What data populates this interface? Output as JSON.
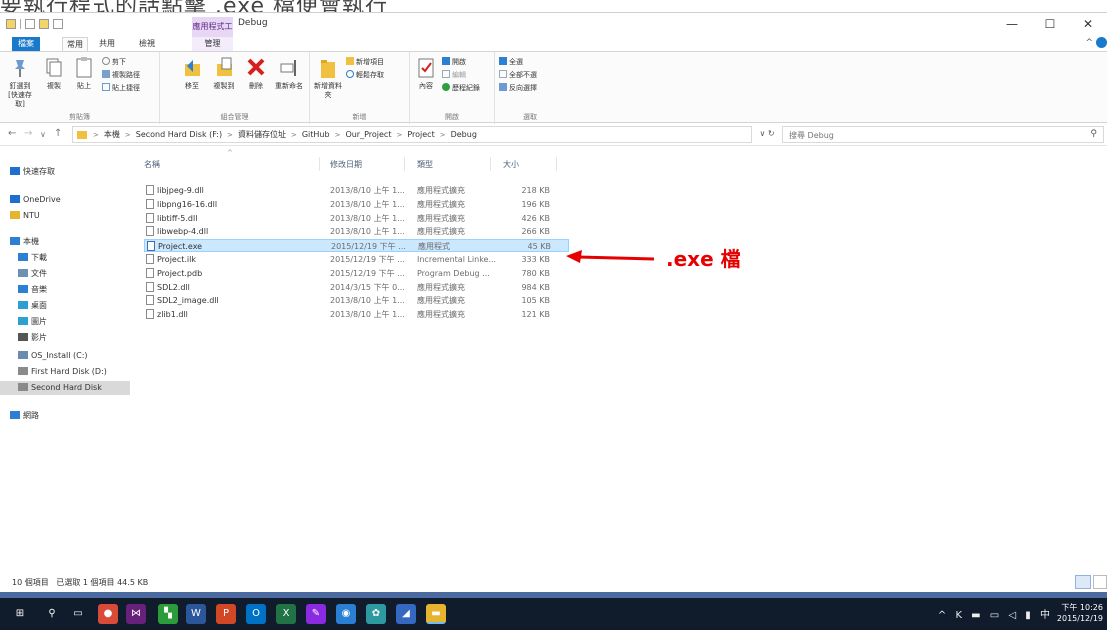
{
  "caption": {
    "partial_text": "要執行程式的話點擊 .exe 檔便會執行"
  },
  "window": {
    "title": "Debug",
    "context_tab_label": "應用程式工具",
    "controls": {
      "minimize": "—",
      "maximize": "☐",
      "close": "✕"
    }
  },
  "ribbon_tabs": {
    "file": "檔案",
    "home": "常用",
    "share": "共用",
    "view": "檢視",
    "manage": "管理",
    "collapse": "^"
  },
  "ribbon": {
    "clipboard": {
      "label": "剪貼簿",
      "pin": "釘選到 [快速存取]",
      "copy": "複製",
      "paste": "貼上",
      "cut": "剪下",
      "copy_path": "複製路徑",
      "paste_shortcut": "貼上捷徑"
    },
    "organize": {
      "label": "組合管理",
      "move_to": "移至",
      "copy_to": "複製到",
      "delete": "刪除",
      "rename": "重新命名"
    },
    "new": {
      "label": "新增",
      "new_folder": "新增資料夾",
      "new_item": "新增項目",
      "easy_access": "輕鬆存取"
    },
    "open": {
      "label": "開啟",
      "properties": "內容",
      "open": "開啟",
      "edit": "編輯",
      "history": "歷程紀錄"
    },
    "select": {
      "label": "選取",
      "select_all": "全選",
      "select_none": "全部不選",
      "invert": "反向選擇"
    }
  },
  "address": {
    "back": "←",
    "forward": "→",
    "recent": "∨",
    "up": "↑",
    "crumbs": [
      "本機",
      "Second Hard Disk (F:)",
      "資料儲存位址",
      "GitHub",
      "Our_Project",
      "Project",
      "Debug"
    ],
    "dropdown": "∨",
    "refresh": "↻",
    "search_placeholder": "搜尋 Debug"
  },
  "nav": {
    "items": [
      {
        "label": "快速存取",
        "icon": "star-icon",
        "color": "#1e6fd0"
      },
      {
        "label": "OneDrive",
        "icon": "cloud-icon",
        "color": "#1e6fd0"
      },
      {
        "label": "NTU",
        "icon": "folder-icon",
        "color": "#e6b530"
      },
      {
        "label": "本機",
        "icon": "computer-icon",
        "color": "#2d7fd1"
      },
      {
        "label": "下載",
        "icon": "download-icon",
        "color": "#2d7fd1"
      },
      {
        "label": "文件",
        "icon": "document-icon",
        "color": "#6f8fb3"
      },
      {
        "label": "音樂",
        "icon": "music-icon",
        "color": "#2d7fd1"
      },
      {
        "label": "桌面",
        "icon": "desktop-icon",
        "color": "#2d9fd1"
      },
      {
        "label": "圖片",
        "icon": "picture-icon",
        "color": "#2d9fd1"
      },
      {
        "label": "影片",
        "icon": "video-icon",
        "color": "#555555"
      },
      {
        "label": "OS_Install (C:)",
        "icon": "drive-icon",
        "color": "#6a8cb0"
      },
      {
        "label": "First Hard Disk (D:)",
        "icon": "drive-icon",
        "color": "#8a8a8a"
      },
      {
        "label": "Second Hard Disk",
        "icon": "drive-icon",
        "color": "#8a8a8a"
      },
      {
        "label": "網路",
        "icon": "network-icon",
        "color": "#2d7fd1"
      }
    ]
  },
  "columns": {
    "name": "名稱",
    "date": "修改日期",
    "type": "類型",
    "size": "大小",
    "sort_indicator": "^"
  },
  "files": [
    {
      "name": "libjpeg-9.dll",
      "date": "2013/8/10 上午 1...",
      "type": "應用程式擴充",
      "size": "218 KB",
      "icon": "dll-icon",
      "selected": false
    },
    {
      "name": "libpng16-16.dll",
      "date": "2013/8/10 上午 1...",
      "type": "應用程式擴充",
      "size": "196 KB",
      "icon": "dll-icon",
      "selected": false
    },
    {
      "name": "libtiff-5.dll",
      "date": "2013/8/10 上午 1...",
      "type": "應用程式擴充",
      "size": "426 KB",
      "icon": "dll-icon",
      "selected": false
    },
    {
      "name": "libwebp-4.dll",
      "date": "2013/8/10 上午 1...",
      "type": "應用程式擴充",
      "size": "266 KB",
      "icon": "dll-icon",
      "selected": false
    },
    {
      "name": "Project.exe",
      "date": "2015/12/19 下午 ...",
      "type": "應用程式",
      "size": "45 KB",
      "icon": "exe-icon",
      "selected": true
    },
    {
      "name": "Project.ilk",
      "date": "2015/12/19 下午 ...",
      "type": "Incremental Linke...",
      "size": "333 KB",
      "icon": "ilk-icon",
      "selected": false
    },
    {
      "name": "Project.pdb",
      "date": "2015/12/19 下午 ...",
      "type": "Program Debug ...",
      "size": "780 KB",
      "icon": "pdb-icon",
      "selected": false
    },
    {
      "name": "SDL2.dll",
      "date": "2014/3/15 下午 0...",
      "type": "應用程式擴充",
      "size": "984 KB",
      "icon": "dll-icon",
      "selected": false
    },
    {
      "name": "SDL2_image.dll",
      "date": "2013/8/10 上午 1...",
      "type": "應用程式擴充",
      "size": "105 KB",
      "icon": "dll-icon",
      "selected": false
    },
    {
      "name": "zlib1.dll",
      "date": "2013/8/10 上午 1...",
      "type": "應用程式擴充",
      "size": "121 KB",
      "icon": "dll-icon",
      "selected": false
    }
  ],
  "annotation": {
    "text": ".exe 檔",
    "color": "#e60000"
  },
  "status": {
    "count": "10 個項目",
    "selection": "已選取 1 個項目 44.5 KB"
  },
  "taskbar": {
    "items": [
      {
        "icon": "windows-start-icon",
        "glyph": "⊞",
        "color": "#101b2c"
      },
      {
        "icon": "search-icon",
        "glyph": "⚲",
        "color": "#101b2c"
      },
      {
        "icon": "task-view-icon",
        "glyph": "▭",
        "color": "#101b2c"
      },
      {
        "icon": "chrome-icon",
        "glyph": "●",
        "color": "#d94a38"
      },
      {
        "icon": "visual-studio-icon",
        "glyph": "⋈",
        "color": "#68217a"
      },
      {
        "icon": "app-grid-icon",
        "glyph": "▚",
        "color": "#2b9b3b"
      },
      {
        "icon": "word-icon",
        "glyph": "W",
        "color": "#2b579a"
      },
      {
        "icon": "powerpoint-icon",
        "glyph": "P",
        "color": "#d24726"
      },
      {
        "icon": "outlook-icon",
        "glyph": "O",
        "color": "#0072c6"
      },
      {
        "icon": "excel-icon",
        "glyph": "X",
        "color": "#217346"
      },
      {
        "icon": "pen-icon",
        "glyph": "✎",
        "color": "#8a2be2"
      },
      {
        "icon": "paint-icon",
        "glyph": "◉",
        "color": "#2a7fd4"
      },
      {
        "icon": "network-app-icon",
        "glyph": "✿",
        "color": "#2c9aa0"
      },
      {
        "icon": "media-icon",
        "glyph": "◢",
        "color": "#3568c0"
      },
      {
        "icon": "file-explorer-icon",
        "glyph": "▬",
        "color": "#e6b530"
      }
    ],
    "tray_icons": "^ K ▬ ▭ ◁ ▮ 中",
    "time": "下午 10:26",
    "date": "2015/12/19"
  }
}
